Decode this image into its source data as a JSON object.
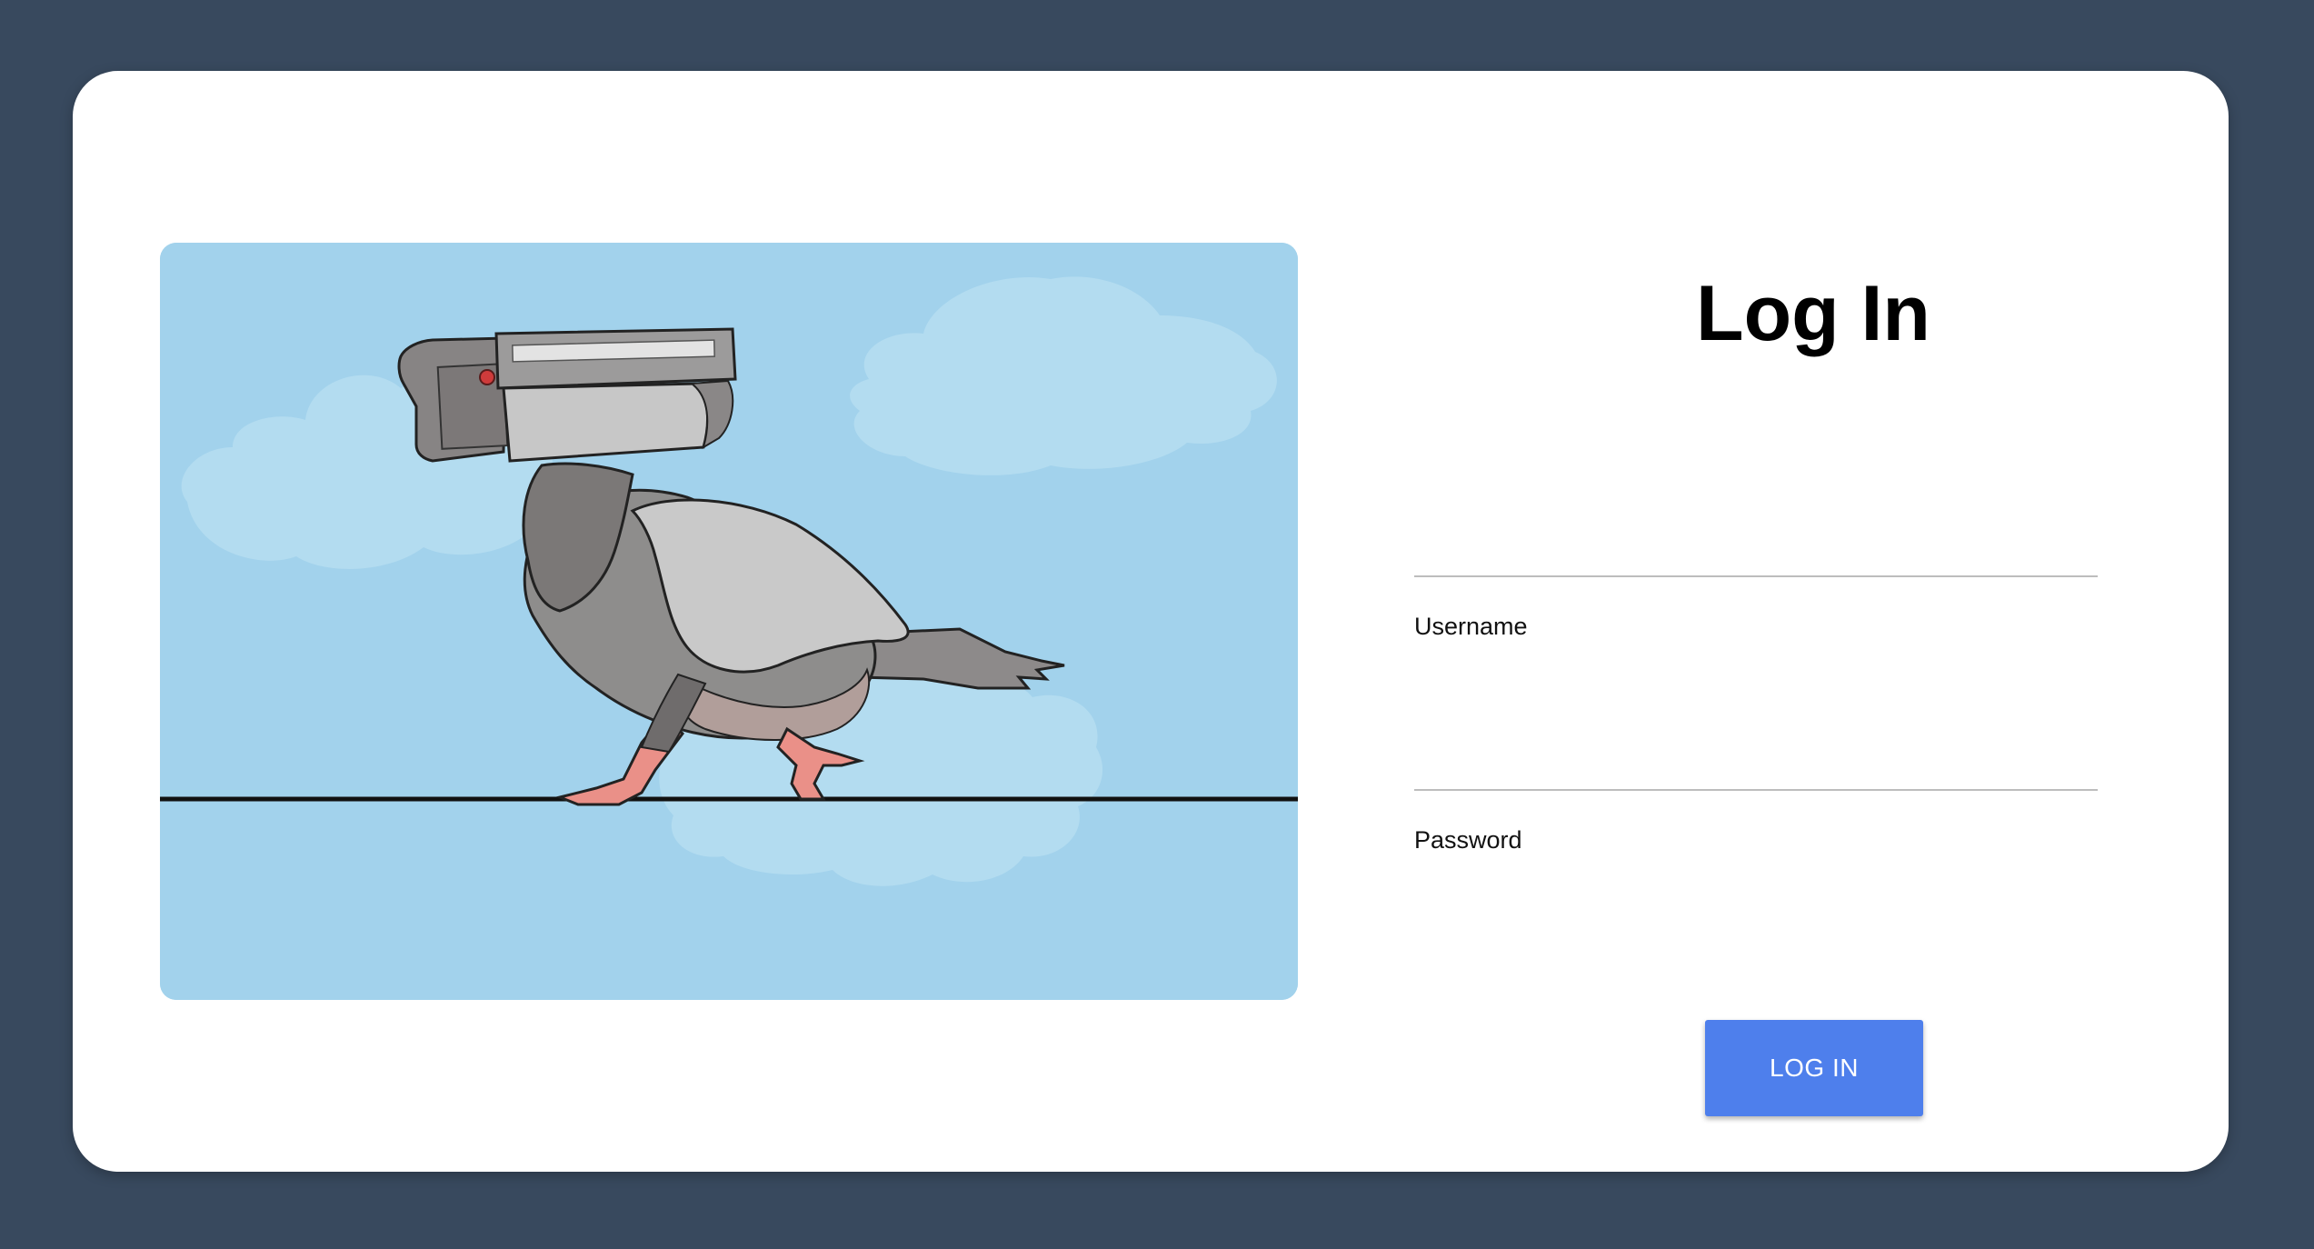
{
  "login": {
    "title": "Log In",
    "username_label": "Username",
    "username_value": "",
    "password_label": "Password",
    "password_value": "",
    "submit_label": "LOG IN"
  },
  "colors": {
    "background": "#38495e",
    "card": "#ffffff",
    "sky": "#a2d2ec",
    "cloud": "#b3dcf0",
    "button": "#4e7fec",
    "field_line": "#bdbdbd"
  },
  "illustration": {
    "icon": "pigeon-surveillance-camera-illustration"
  }
}
